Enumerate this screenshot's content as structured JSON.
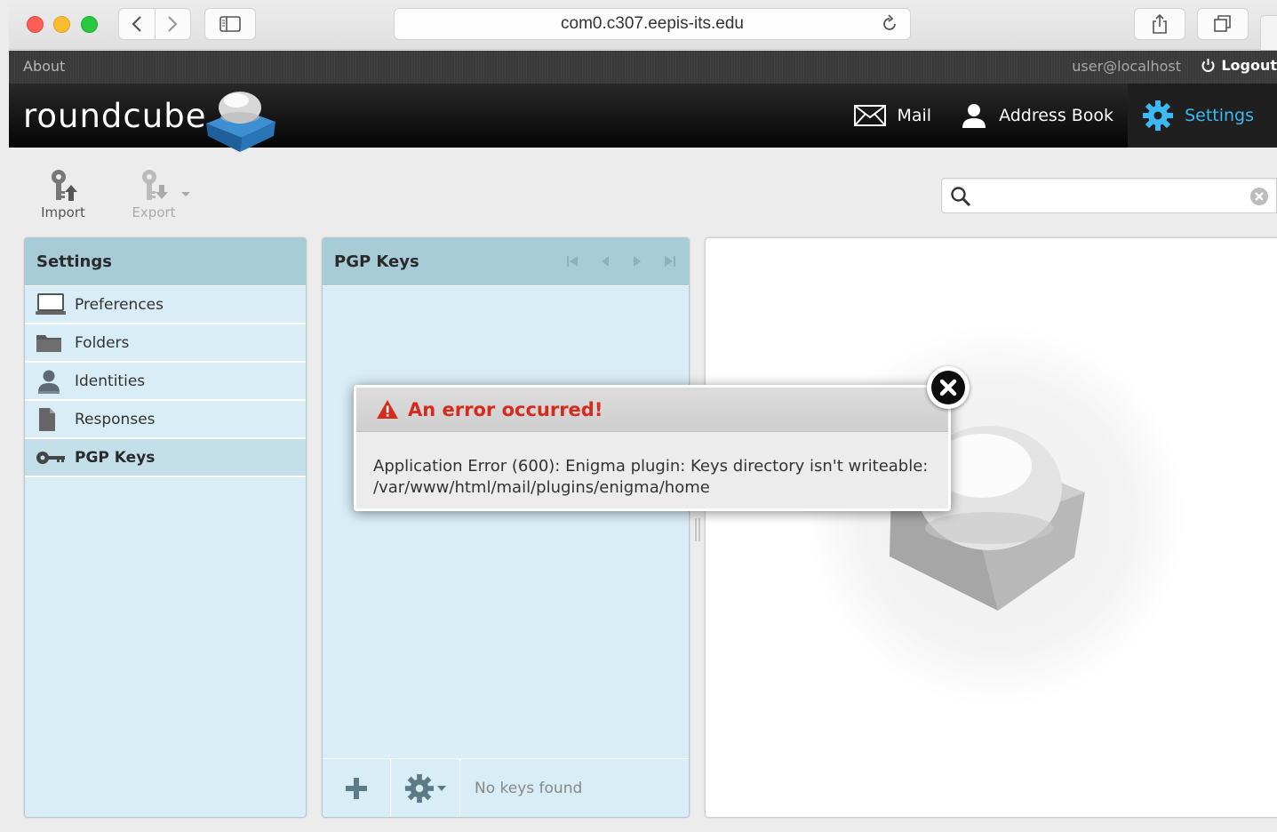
{
  "browser": {
    "url": "com0.c307.eepis-its.edu"
  },
  "topline": {
    "about": "About",
    "username": "user@localhost",
    "logout": "Logout"
  },
  "header": {
    "logo_text": "roundcube",
    "tasks": [
      {
        "label": "Mail",
        "icon": "envelope-icon"
      },
      {
        "label": "Address Book",
        "icon": "person-icon"
      },
      {
        "label": "Settings",
        "icon": "gear-icon",
        "selected": true
      }
    ]
  },
  "toolbar": {
    "import_label": "Import",
    "export_label": "Export"
  },
  "search": {
    "value": "",
    "placeholder": ""
  },
  "settings_panel": {
    "title": "Settings",
    "items": [
      {
        "label": "Preferences",
        "icon": "monitor-icon"
      },
      {
        "label": "Folders",
        "icon": "folder-icon"
      },
      {
        "label": "Identities",
        "icon": "person-icon"
      },
      {
        "label": "Responses",
        "icon": "document-icon"
      },
      {
        "label": "PGP Keys",
        "icon": "key-icon",
        "selected": true
      }
    ]
  },
  "keys_panel": {
    "title": "PGP Keys",
    "status": "No keys found"
  },
  "error_dialog": {
    "title": "An error occurred!",
    "message": "Application Error (600): Enigma plugin: Keys directory isn't writeable: /var/www/html/mail/plugins/enigma/home"
  },
  "colors": {
    "accent": "#3cb8f3",
    "error": "#d62a1d",
    "panel_bg": "#d8edf5",
    "panel_header": "#a8cbd8"
  }
}
